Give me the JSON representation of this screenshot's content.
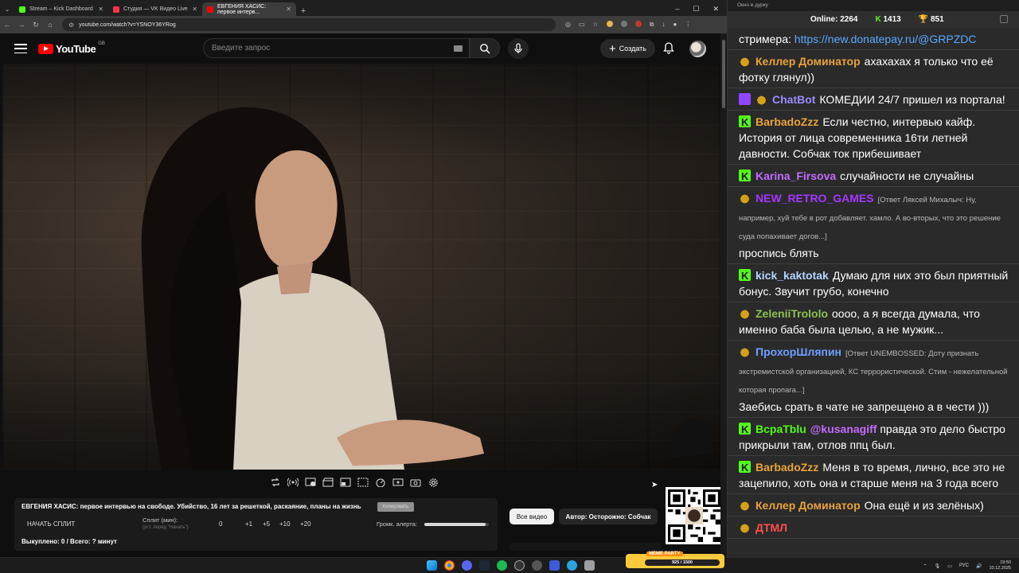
{
  "browser": {
    "tabs": [
      {
        "title": "Stream – Kick Dashboard",
        "favicon_color": "#53fc18"
      },
      {
        "title": "Студия — VK Видео Live",
        "favicon_color": "#ff3347"
      },
      {
        "title": "ЕВГЕНИЯ ХАСИС: первое интерв...",
        "favicon_color": "#ff0000",
        "active": true
      }
    ],
    "url": "youtube.com/watch?v=YSNOY36YRog"
  },
  "youtube": {
    "logo_text": "YouTube",
    "country": "GB",
    "search_placeholder": "Введите запрос",
    "create_label": "Создать"
  },
  "panel": {
    "title": "ЕВГЕНИЯ ХАСИС: первое интервью на свободе. Убийство, 16 лет за решеткой, раскаяние, планы на жизнь",
    "copy_label": "Копировать",
    "start_split": "НАЧАТЬ СПЛИТ",
    "split_label": "Сплит (мин):",
    "split_hint": "(уст. перед \"Начать\")",
    "split_values": [
      "0",
      "+1",
      "+5",
      "+10",
      "+20"
    ],
    "alert_volume_label": "Громк. алерта:",
    "alert_volume": 0.95,
    "stats": "Выкуплено: 0 / Всего: ? минут"
  },
  "chips": {
    "all_videos": "Все видео",
    "author": "Автор: Осторожно: Собчак"
  },
  "chat": {
    "window_title": "Окно в дурку",
    "online_label": "Online:",
    "online_count": "2264",
    "kick_count": "1413",
    "vk_count": "851",
    "messages": [
      {
        "badge": "",
        "user": "",
        "user_color": "#ffffff",
        "reply": "",
        "text": "стримера: ",
        "link": "https://new.donatepay.ru/@GRPZDC"
      },
      {
        "badge": "cup",
        "user": "Келлер Доминатор",
        "user_color": "#e9a33b",
        "reply": "",
        "text": "ахахахах я только что её фотку глянул))",
        "link": ""
      },
      {
        "badge": "bot",
        "user": "ChatBot",
        "user_color": "#9b8cff",
        "reply": "",
        "text": "КОМЕДИИ 24/7 пришел из портала!",
        "link": "",
        "bot": true
      },
      {
        "badge": "k",
        "user": "BarbadoZzz",
        "user_color": "#e9a33b",
        "reply": "",
        "text": "Если честно, интервью кайф. История от лица современника 16ти летней давности. Собчак ток прибешивает",
        "link": ""
      },
      {
        "badge": "k",
        "user": "Karina_Firsova",
        "user_color": "#c46bff",
        "reply": "",
        "text": "случайности не случайны",
        "link": ""
      },
      {
        "badge": "cup",
        "user": "NEW_RETRO_GAMES",
        "user_color": "#a637ff",
        "reply": "[Ответ Ляксей Михалыч: Ну, например, хуй тебе в  рот добавляет. хамло. А во-вторых, что это  решение суда попахивает догов...]",
        "text": "проспись блять",
        "link": ""
      },
      {
        "badge": "k",
        "user": "kick_kaktotak",
        "user_color": "#b2d4ff",
        "reply": "",
        "text": "Думаю для них это был приятный бонус. Звучит грубо, конечно",
        "link": ""
      },
      {
        "badge": "cup",
        "user": "ZeleniiTrololo",
        "user_color": "#8cc152",
        "reply": "",
        "text": "оооо, а я всегда думала, что именно баба была целью, а не мужик...",
        "link": ""
      },
      {
        "badge": "cup",
        "user": "ПрохорШляпин",
        "user_color": "#6f9fff",
        "reply": "[Ответ UNEMBOSSED: Доту признать экстремистской организацией, КС террористической. Стим - нежелательной которая пропага...]",
        "text": "Заебись срать в чате не запрещено а в чести )))",
        "link": ""
      },
      {
        "badge": "k",
        "user": "BcpaTblu",
        "user_color": "#53fc18",
        "reply": "",
        "text": "@kusanagiff правда это дело быстро прикрыли там, отлов ппц был.",
        "link": "",
        "mention": "@kusanagiff"
      },
      {
        "badge": "k",
        "user": "BarbadoZzz",
        "user_color": "#e9a33b",
        "reply": "",
        "text": "Меня в то время, лично, все это не зацепило, хоть она и старше меня на 3 года всего",
        "link": ""
      },
      {
        "badge": "cup",
        "user": "Келлер Доминатор",
        "user_color": "#e9a33b",
        "reply": "",
        "text": "Она ещё и из зелёных)",
        "link": ""
      },
      {
        "badge": "cup",
        "user": "ДТМЛ",
        "user_color": "#ff4d4d",
        "reply": "",
        "text": "",
        "link": ""
      }
    ]
  },
  "taskbar": {
    "meme_title": "MEME PARTY",
    "meme_progress": "925 / 1500",
    "lang": "РУС",
    "time": "19:50",
    "date": "10.12.2025"
  }
}
